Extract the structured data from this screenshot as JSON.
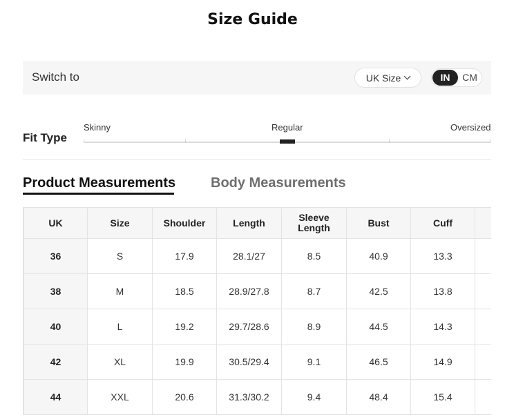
{
  "title": "Size Guide",
  "switch": {
    "label": "Switch to",
    "size_select": "UK Size",
    "units": [
      "IN",
      "CM"
    ],
    "active_unit": "IN"
  },
  "fit": {
    "label": "Fit Type",
    "options": [
      "Skinny",
      "Regular",
      "Oversized"
    ],
    "selected": "Regular"
  },
  "tabs": {
    "active": "Product Measurements",
    "inactive": "Body Measurements"
  },
  "table": {
    "headers": [
      "UK",
      "Size",
      "Shoulder",
      "Length",
      "Sleeve Length",
      "Bust",
      "Cuff",
      ""
    ],
    "rows": [
      [
        "36",
        "S",
        "17.9",
        "28.1/27",
        "8.5",
        "40.9",
        "13.3",
        ""
      ],
      [
        "38",
        "M",
        "18.5",
        "28.9/27.8",
        "8.7",
        "42.5",
        "13.8",
        ""
      ],
      [
        "40",
        "L",
        "19.2",
        "29.7/28.6",
        "8.9",
        "44.5",
        "14.3",
        ""
      ],
      [
        "42",
        "XL",
        "19.9",
        "30.5/29.4",
        "9.1",
        "46.5",
        "14.9",
        ""
      ],
      [
        "44",
        "XXL",
        "20.6",
        "31.3/30.2",
        "9.4",
        "48.4",
        "15.4",
        ""
      ]
    ]
  }
}
